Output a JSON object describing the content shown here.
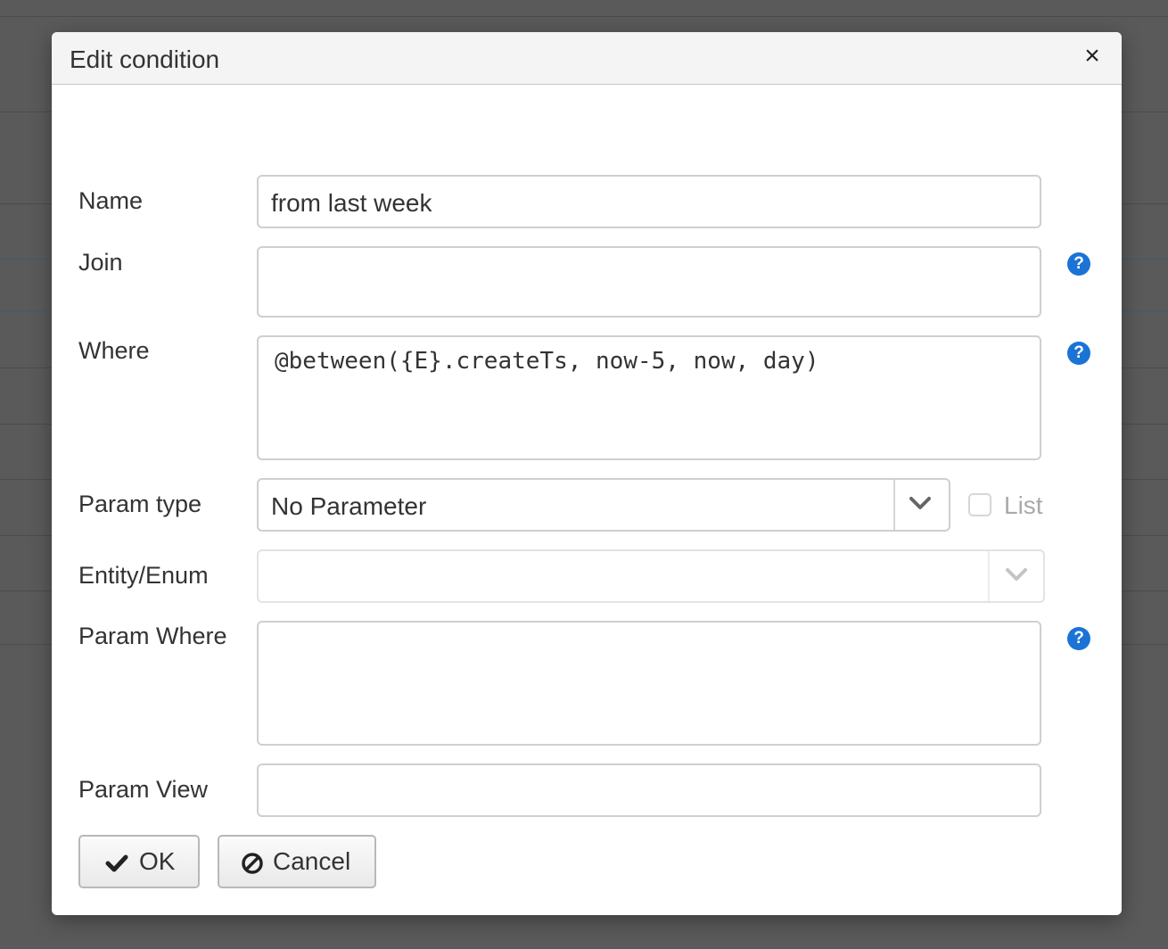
{
  "dialog": {
    "title": "Edit condition",
    "close_glyph": "×"
  },
  "form": {
    "name": {
      "label": "Name",
      "value": "from last week"
    },
    "join": {
      "label": "Join",
      "value": ""
    },
    "where": {
      "label": "Where",
      "value": "@between({E}.createTs, now-5, now, day)"
    },
    "param_type": {
      "label": "Param type",
      "value": "No Parameter"
    },
    "list_checkbox": {
      "label": "List",
      "checked": false
    },
    "entity_enum": {
      "label": "Entity/Enum",
      "value": ""
    },
    "param_where": {
      "label": "Param Where",
      "value": ""
    },
    "param_view": {
      "label": "Param View",
      "value": ""
    }
  },
  "help": {
    "glyph": "?"
  },
  "buttons": {
    "ok": {
      "label": "OK",
      "icon": "check-icon"
    },
    "cancel": {
      "label": "Cancel",
      "icon": "ban-icon"
    }
  },
  "colors": {
    "help_icon": "#1b73d6",
    "overlay": "#5a5a5a"
  }
}
